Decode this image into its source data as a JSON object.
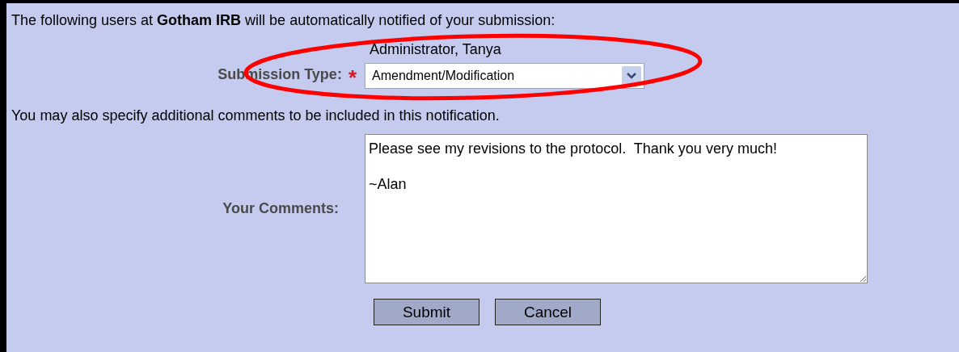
{
  "notice": "The following users at **Gotham IRB** will be automatically notified of your submission:",
  "recipients": [
    "Administrator, Tanya"
  ],
  "submission_type": {
    "label": "Submission Type:",
    "required_mark": "*",
    "value": "Amendment/Modification"
  },
  "comments_note": "You may also specify additional comments to be included in this notification.",
  "comments": {
    "label": "Your Comments:",
    "value": "Please see my revisions to the protocol.  Thank you very much!\n\n~Alan"
  },
  "buttons": [
    "Submit",
    "Cancel"
  ],
  "annotation": {
    "kind": "ellipse"
  }
}
